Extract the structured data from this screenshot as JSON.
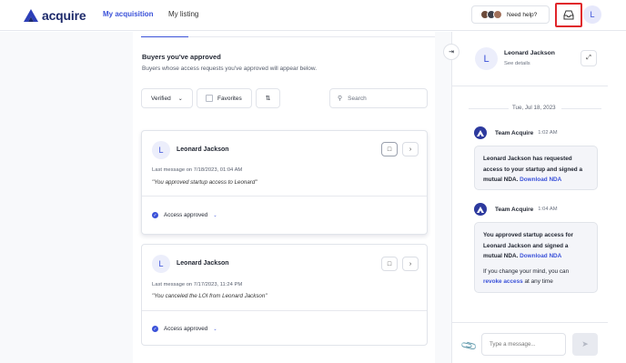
{
  "header": {
    "logo_text": "acquire",
    "nav": [
      {
        "label": "My acquisition",
        "active": true
      },
      {
        "label": "My listing",
        "active": false
      }
    ],
    "help_label": "Need help?",
    "user_initial": "L",
    "accent_color": "#3b52d9"
  },
  "main": {
    "section_title": "Buyers you've approved",
    "section_subtitle": "Buyers whose access requests you've approved will appear below.",
    "filters": {
      "verified_label": "Verified",
      "favorites_label": "Favorites",
      "search_placeholder": "Search"
    },
    "cards": [
      {
        "initial": "L",
        "name": "Leonard Jackson",
        "last_message": "Last message on 7/18/2023, 01:04 AM",
        "message": "\"You approved startup access to Leonard\"",
        "status": "Access approved"
      },
      {
        "initial": "L",
        "name": "Leonard Jackson",
        "last_message": "Last message on 7/17/2023, 11:24 PM",
        "message": "\"You canceled the LOI from Leonard Jackson\"",
        "status": "Access approved"
      }
    ]
  },
  "chat": {
    "contact_initial": "L",
    "contact_name": "Leonard Jackson",
    "see_details": "See details",
    "date": "Tue, Jul 18, 2023",
    "messages": [
      {
        "sender": "Team Acquire",
        "time": "1:02 AM",
        "text": "Leonard Jackson has requested access to your startup and signed a mutual NDA.",
        "link": "Download NDA"
      },
      {
        "sender": "Team Acquire",
        "time": "1:04 AM",
        "text": "You approved startup access for Leonard Jackson and signed a mutual NDA.",
        "link": "Download NDA",
        "note_before": "If you change your mind, you can",
        "note_link": "revoke access",
        "note_after": "at any time"
      }
    ],
    "input_placeholder": "Type a message..."
  }
}
